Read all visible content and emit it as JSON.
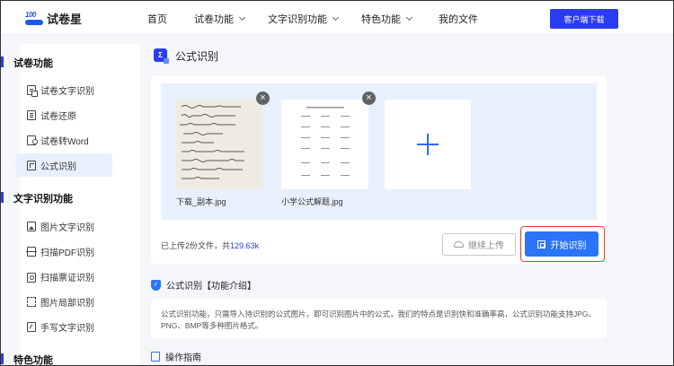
{
  "header": {
    "logo_text": "试卷星",
    "logo_badge": "100",
    "nav": [
      "首页",
      "试卷功能",
      "文字识别功能",
      "特色功能",
      "我的文件"
    ],
    "download_label": "客户端下载"
  },
  "sidebar": {
    "groups": [
      {
        "title": "试卷功能",
        "items": [
          {
            "label": "试卷文字识别",
            "icon": "document-text-icon"
          },
          {
            "label": "试卷还原",
            "icon": "document-restore-icon"
          },
          {
            "label": "试卷转Word",
            "icon": "word-convert-icon"
          },
          {
            "label": "公式识别",
            "icon": "formula-icon",
            "active": true
          }
        ]
      },
      {
        "title": "文字识别功能",
        "items": [
          {
            "label": "图片文字识别",
            "icon": "image-text-icon"
          },
          {
            "label": "扫描PDF识别",
            "icon": "scan-pdf-icon"
          },
          {
            "label": "扫描票证识别",
            "icon": "ticket-card-icon"
          },
          {
            "label": "图片局部识别",
            "icon": "image-partial-icon"
          },
          {
            "label": "手写文字识别",
            "icon": "handwriting-icon"
          }
        ]
      },
      {
        "title": "特色功能",
        "items": []
      }
    ]
  },
  "main": {
    "title": "公式识别",
    "title_icon_text": "Σ",
    "files": [
      {
        "name": "下载_副本.jpg"
      },
      {
        "name": "小学公式解题.jpg"
      }
    ],
    "status_prefix": "已上传2份文件，共",
    "status_size": "129.63k",
    "continue_label": "继续上传",
    "start_label": "开始识别",
    "intro_title": "公式识别【功能介绍】",
    "intro_text": "公式识别功能，只需导入待识别的公式图片，即可识别图片中的公式，我们的特点是识别快和准确率高，公式识别功能支持JPG、PNG、BMP等多种图片格式。",
    "guide_title": "操作指南"
  },
  "colors": {
    "brand": "#2a3cf3",
    "primary_button": "#2a74f8",
    "highlight_outline": "#d9463b",
    "upload_area": "#e8f0fd"
  }
}
